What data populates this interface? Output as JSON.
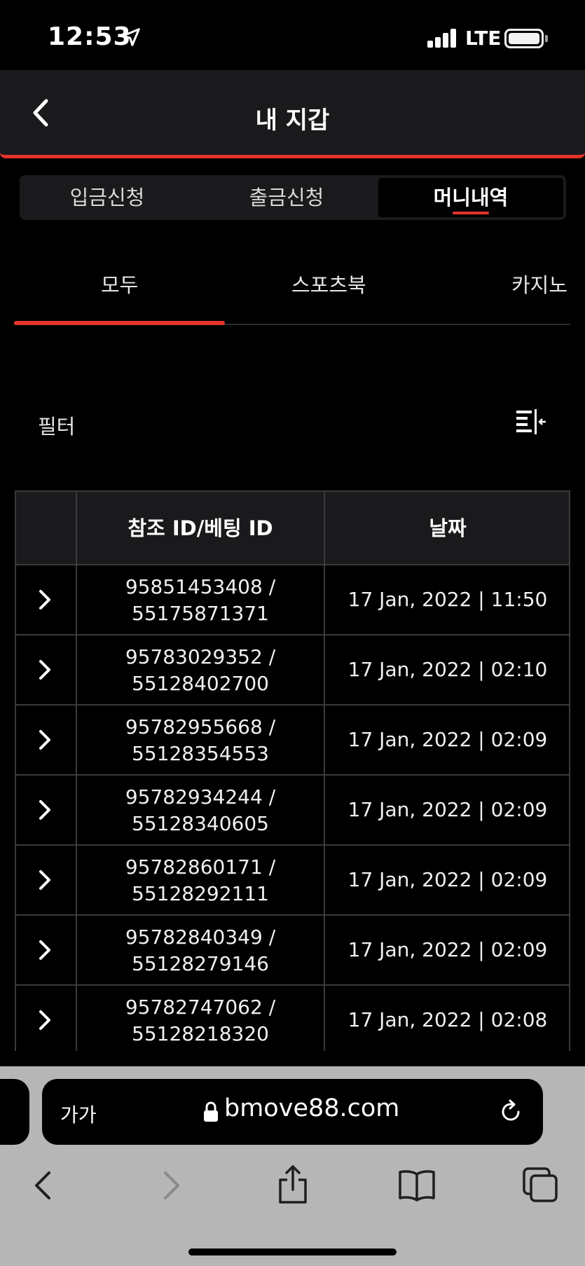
{
  "status": {
    "time": "12:53",
    "network": "LTE"
  },
  "header": {
    "title": "내 지갑"
  },
  "wallet_tabs": [
    {
      "label": "입금신청",
      "active": false
    },
    {
      "label": "출금신청",
      "active": false
    },
    {
      "label": "머니내역",
      "active": true
    }
  ],
  "categories": [
    {
      "label": "모두",
      "active": true
    },
    {
      "label": "스포츠북",
      "active": false
    },
    {
      "label": "카지노",
      "active": false
    }
  ],
  "filter": {
    "label": "필터",
    "icon": "filter-icon"
  },
  "table": {
    "headers": [
      "",
      "참조 ID/베팅 ID",
      "날짜"
    ],
    "rows": [
      {
        "ref": "95851453408 /",
        "bet": "55175871371",
        "date": "17 Jan, 2022 | 11:50"
      },
      {
        "ref": "95783029352 /",
        "bet": "55128402700",
        "date": "17 Jan, 2022 | 02:10"
      },
      {
        "ref": "95782955668 /",
        "bet": "55128354553",
        "date": "17 Jan, 2022 | 02:09"
      },
      {
        "ref": "95782934244 /",
        "bet": "55128340605",
        "date": "17 Jan, 2022 | 02:09"
      },
      {
        "ref": "95782860171 /",
        "bet": "55128292111",
        "date": "17 Jan, 2022 | 02:09"
      },
      {
        "ref": "95782840349 /",
        "bet": "55128279146",
        "date": "17 Jan, 2022 | 02:09"
      },
      {
        "ref": "95782747062 /",
        "bet": "55128218320",
        "date": "17 Jan, 2022 | 02:08"
      }
    ]
  },
  "browser": {
    "aa_label": "가가",
    "url": "bmove88.com"
  },
  "colors": {
    "accent": "#e3342a",
    "surface": "#1a1a1d",
    "background": "#000000",
    "toolbar": "#b6b6b6"
  }
}
